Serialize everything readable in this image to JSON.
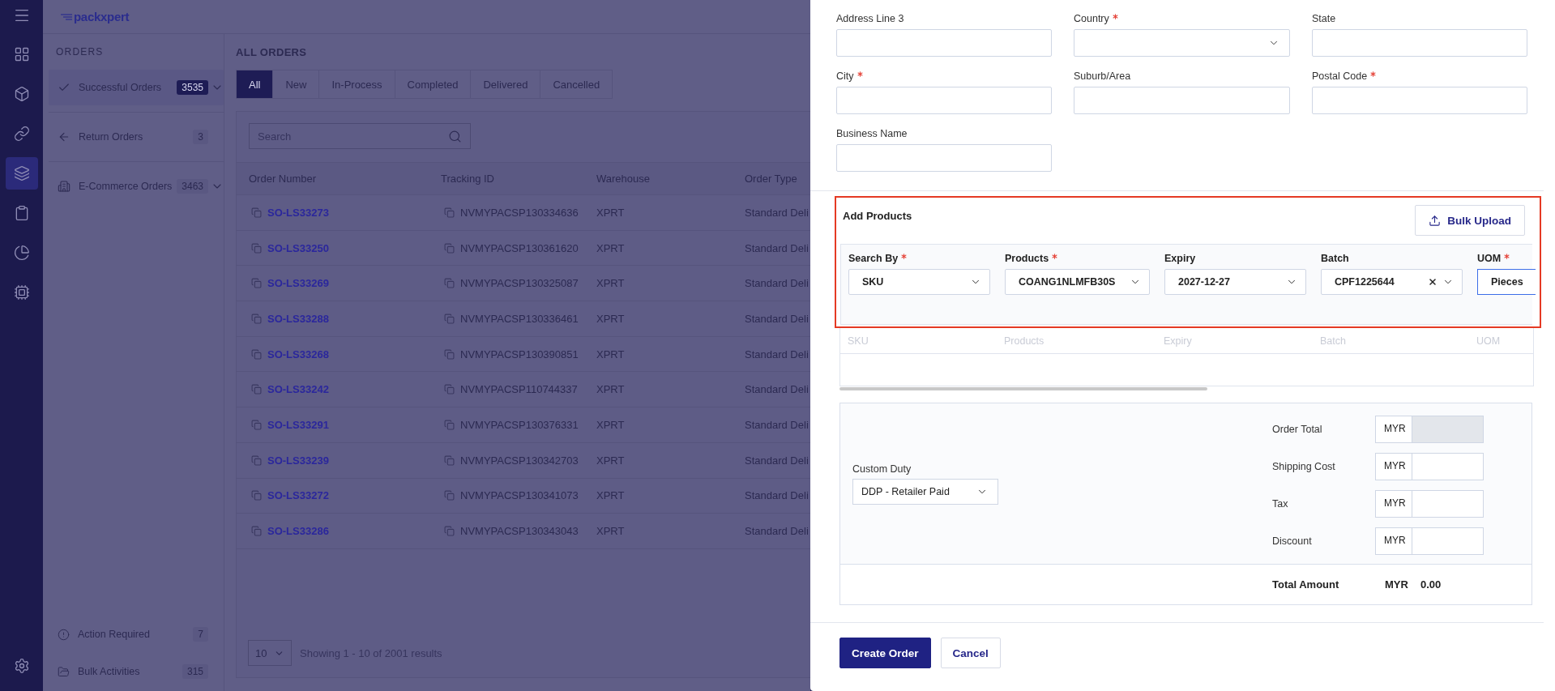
{
  "logo": "packxpert",
  "rail": {
    "items": [
      {
        "selected": false
      },
      {
        "selected": false
      },
      {
        "selected": false
      },
      {
        "selected": true
      },
      {
        "selected": false
      },
      {
        "selected": false
      },
      {
        "selected": false
      }
    ]
  },
  "orders_panel": {
    "title": "ORDERS",
    "items": [
      {
        "label": "Successful Orders",
        "count": "3535",
        "selected": true,
        "has_submenu": true
      },
      {
        "label": "Return Orders",
        "count": "3",
        "selected": false,
        "has_submenu": false
      },
      {
        "label": "E-Commerce Orders",
        "count": "3463",
        "selected": false,
        "has_submenu": true
      }
    ],
    "footer_items": [
      {
        "label": "Action Required",
        "count": "7"
      },
      {
        "label": "Bulk Activities",
        "count": "315"
      }
    ]
  },
  "main": {
    "title": "ALL ORDERS",
    "tabs": [
      {
        "label": "All",
        "selected": true
      },
      {
        "label": "New",
        "selected": false
      },
      {
        "label": "In-Process",
        "selected": false
      },
      {
        "label": "Completed",
        "selected": false
      },
      {
        "label": "Delivered",
        "selected": false
      },
      {
        "label": "Cancelled",
        "selected": false
      }
    ],
    "search": {
      "placeholder": "Search"
    },
    "table": {
      "columns": [
        "Order Number",
        "Tracking ID",
        "Warehouse",
        "Order Type"
      ],
      "rows": [
        {
          "order_number": "SO-LS33273",
          "tracking_id": "NVMYPACSP130334636",
          "warehouse": "XPRT",
          "order_type": "Standard Deli"
        },
        {
          "order_number": "SO-LS33250",
          "tracking_id": "NVMYPACSP130361620",
          "warehouse": "XPRT",
          "order_type": "Standard Deli"
        },
        {
          "order_number": "SO-LS33269",
          "tracking_id": "NVMYPACSP130325087",
          "warehouse": "XPRT",
          "order_type": "Standard Deli"
        },
        {
          "order_number": "SO-LS33288",
          "tracking_id": "NVMYPACSP130336461",
          "warehouse": "XPRT",
          "order_type": "Standard Deli"
        },
        {
          "order_number": "SO-LS33268",
          "tracking_id": "NVMYPACSP130390851",
          "warehouse": "XPRT",
          "order_type": "Standard Deli"
        },
        {
          "order_number": "SO-LS33242",
          "tracking_id": "NVMYPACSP110744337",
          "warehouse": "XPRT",
          "order_type": "Standard Deli"
        },
        {
          "order_number": "SO-LS33291",
          "tracking_id": "NVMYPACSP130376331",
          "warehouse": "XPRT",
          "order_type": "Standard Deli"
        },
        {
          "order_number": "SO-LS33239",
          "tracking_id": "NVMYPACSP130342703",
          "warehouse": "XPRT",
          "order_type": "Standard Deli"
        },
        {
          "order_number": "SO-LS33272",
          "tracking_id": "NVMYPACSP130341073",
          "warehouse": "XPRT",
          "order_type": "Standard Deli"
        },
        {
          "order_number": "SO-LS33286",
          "tracking_id": "NVMYPACSP130343043",
          "warehouse": "XPRT",
          "order_type": "Standard Deli"
        }
      ]
    },
    "pagination": {
      "page_size": "10",
      "summary": "Showing 1 - 10 of 2001 results"
    }
  },
  "drawer": {
    "address_fields": [
      {
        "label": "Address Line 3",
        "required": false,
        "kind": "text"
      },
      {
        "label": "Country",
        "required": true,
        "kind": "select"
      },
      {
        "label": "State",
        "required": false,
        "kind": "text"
      },
      {
        "label": "City",
        "required": true,
        "kind": "text"
      },
      {
        "label": "Suburb/Area",
        "required": false,
        "kind": "text"
      },
      {
        "label": "Postal Code",
        "required": true,
        "kind": "text"
      },
      {
        "label": "Business Name",
        "required": false,
        "kind": "text"
      }
    ],
    "add_products": {
      "title": "Add Products",
      "highlighted": true,
      "bulk_upload": "Bulk Upload",
      "fields": [
        {
          "label": "Search By",
          "required": true,
          "kind": "select",
          "value": "SKU",
          "clearable": false
        },
        {
          "label": "Products",
          "required": true,
          "kind": "select",
          "value": "COANG1NLMFB30S",
          "clearable": false
        },
        {
          "label": "Expiry",
          "required": false,
          "kind": "select",
          "value": "2027-12-27",
          "clearable": false
        },
        {
          "label": "Batch",
          "required": false,
          "kind": "select",
          "value": "CPF1225644",
          "clearable": true
        },
        {
          "label": "UOM",
          "required": true,
          "kind": "text",
          "value": "Pieces",
          "focused": true
        }
      ],
      "table_columns": [
        "SKU",
        "Products",
        "Expiry",
        "Batch",
        "UOM"
      ]
    },
    "summary": {
      "custom_duty": {
        "label": "Custom Duty",
        "value": "DDP - Retailer Paid"
      },
      "charges": [
        {
          "label": "Order Total",
          "currency": "MYR",
          "disabled": true
        },
        {
          "label": "Shipping Cost",
          "currency": "MYR",
          "disabled": false
        },
        {
          "label": "Tax",
          "currency": "MYR",
          "disabled": false
        },
        {
          "label": "Discount",
          "currency": "MYR",
          "disabled": false
        }
      ],
      "total": {
        "label": "Total Amount",
        "currency": "MYR",
        "value": "0.00"
      }
    },
    "actions": [
      {
        "label": "Create Order",
        "kind": "primary"
      },
      {
        "label": "Cancel",
        "kind": "secondary"
      }
    ]
  }
}
